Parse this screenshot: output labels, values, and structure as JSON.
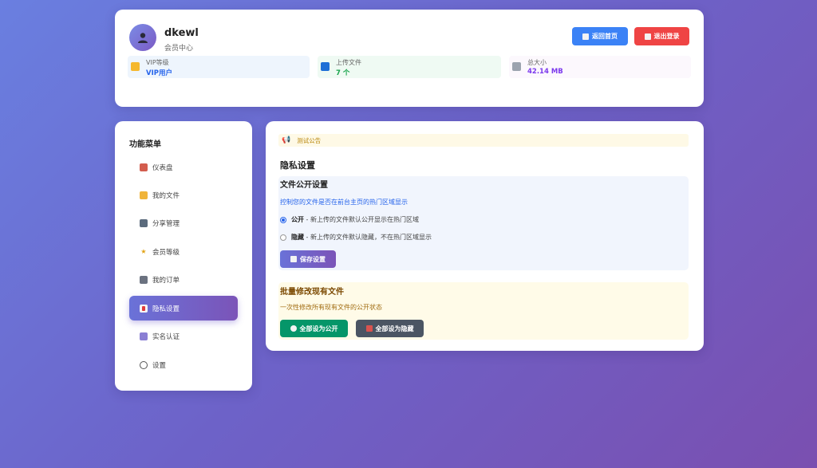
{
  "header": {
    "username": "dkewl",
    "subtitle": "会员中心",
    "home_button": "返回首页",
    "logout_button": "退出登录",
    "stats": [
      {
        "label": "VIP等级",
        "value": "VIP用户"
      },
      {
        "label": "上传文件",
        "value": "7 个"
      },
      {
        "label": "总大小",
        "value": "42.14 MB"
      }
    ]
  },
  "sidebar": {
    "title": "功能菜单",
    "items": [
      {
        "label": "仪表盘"
      },
      {
        "label": "我的文件"
      },
      {
        "label": "分享管理"
      },
      {
        "label": "会员等级"
      },
      {
        "label": "我的订单"
      },
      {
        "label": "隐私设置"
      },
      {
        "label": "实名认证"
      },
      {
        "label": "设置"
      }
    ],
    "active_index": 5
  },
  "main": {
    "notice": "测试公告",
    "section_title": "隐私设置",
    "privacy": {
      "title": "文件公开设置",
      "description": "控制您的文件是否在前台主页的热门区域显示",
      "options": [
        {
          "label": "公开",
          "desc": " - 新上传的文件默认公开显示在热门区域",
          "checked": true
        },
        {
          "label": "隐藏",
          "desc": " - 新上传的文件默认隐藏，不在热门区域显示",
          "checked": false
        }
      ],
      "save_button": "保存设置"
    },
    "batch": {
      "title": "批量修改现有文件",
      "description": "一次性修改所有现有文件的公开状态",
      "public_button": "全部设为公开",
      "hide_button": "全部设为隐藏"
    }
  }
}
